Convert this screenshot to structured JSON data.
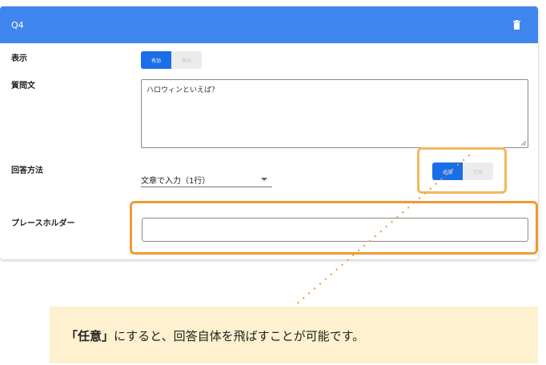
{
  "question": {
    "number_label": "Q4",
    "delete_icon": "trash-icon"
  },
  "display_row": {
    "label": "表示",
    "toggle": {
      "on_label": "有効",
      "off_label": "無効",
      "selected": "on"
    }
  },
  "question_text_row": {
    "label": "質問文",
    "value": "ハロウィンといえば？"
  },
  "answer_method_row": {
    "label": "回答方法",
    "select_value": "文章で入力（1行）",
    "required_toggle": {
      "on_label": "必須",
      "off_label": "任意",
      "selected": "on"
    }
  },
  "placeholder_row": {
    "label": "プレースホルダー",
    "value": ""
  },
  "callout": {
    "emphasis": "「任意」",
    "text": "にすると、回答自体を飛ばすことが可能です。"
  },
  "colors": {
    "header": "#3f86ee",
    "toggle_on": "#1a6fe8",
    "highlight": "#ef9a33",
    "callout_bg": "#fdf1cf"
  }
}
